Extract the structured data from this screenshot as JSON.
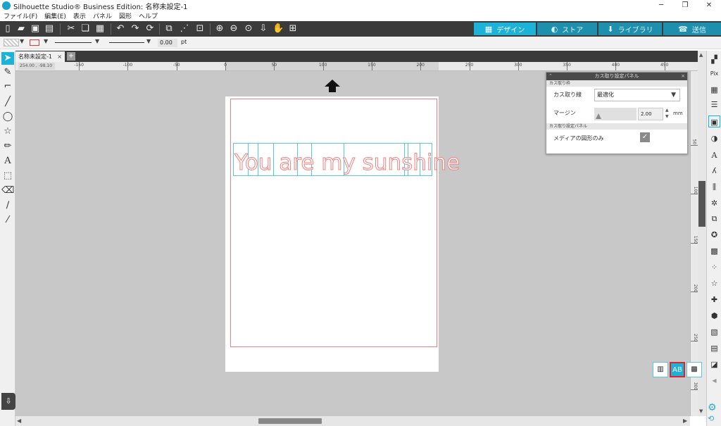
{
  "window": {
    "title": "Silhouette Studio® Business Edition: 名称未設定-1",
    "min": "─",
    "restore": "❐",
    "close": "✕"
  },
  "menu": [
    "ファイル(F)",
    "編集(E)",
    "表示",
    "パネル",
    "図形",
    "ヘルプ"
  ],
  "toolbar": {
    "icons": [
      "new-document-icon",
      "open-folder-icon",
      "save-icon",
      "print-icon",
      "cut-icon",
      "copy-icon",
      "paste-icon",
      "undo-icon",
      "redo-icon",
      "refresh-icon",
      "group-icon",
      "ungroup-icon",
      "compound-icon",
      "zoom-in-icon",
      "zoom-out-icon",
      "zoom-select-icon",
      "pan-down-icon",
      "hand-icon",
      "fit-page-icon"
    ],
    "nav_tabs": [
      {
        "label": "デザイン",
        "icon": "grid-icon",
        "active": true
      },
      {
        "label": "ストア",
        "icon": "store-icon",
        "active": false
      },
      {
        "label": "ライブラリ",
        "icon": "library-icon",
        "active": false
      },
      {
        "label": "送信",
        "icon": "send-icon",
        "active": false
      }
    ],
    "active_color": "#1db3d9",
    "inactive_color": "#1f8fae"
  },
  "linebar": {
    "line_width": "0.00",
    "unit": "pt"
  },
  "doc_tab": {
    "name": "名称未設定-1",
    "close": "×",
    "add": "+"
  },
  "ruler": {
    "coords": "254.00 , -98.10",
    "h_ticks": [
      "-150",
      "-100",
      "-50",
      "0",
      "50",
      "100",
      "150",
      "200",
      "250",
      "300",
      "350",
      "400",
      "450"
    ],
    "v_ticks": [
      "50",
      "100",
      "150",
      "200",
      "250",
      "300"
    ]
  },
  "design": {
    "text": "You are my sunshine",
    "cut_line_color": "#f08080",
    "box_line_color": "#58c8e0"
  },
  "panel": {
    "title": "カス取り設定パネル",
    "section1": "カス取り枠",
    "row1_label": "カス取り線",
    "row1_value": "最適化",
    "row2_label": "マージン",
    "row2_value": "2.00",
    "row2_unit": "mm",
    "section2": "カス取り設定パネル",
    "row3_label": "メディアの図形のみ",
    "row3_checked": true
  }
}
